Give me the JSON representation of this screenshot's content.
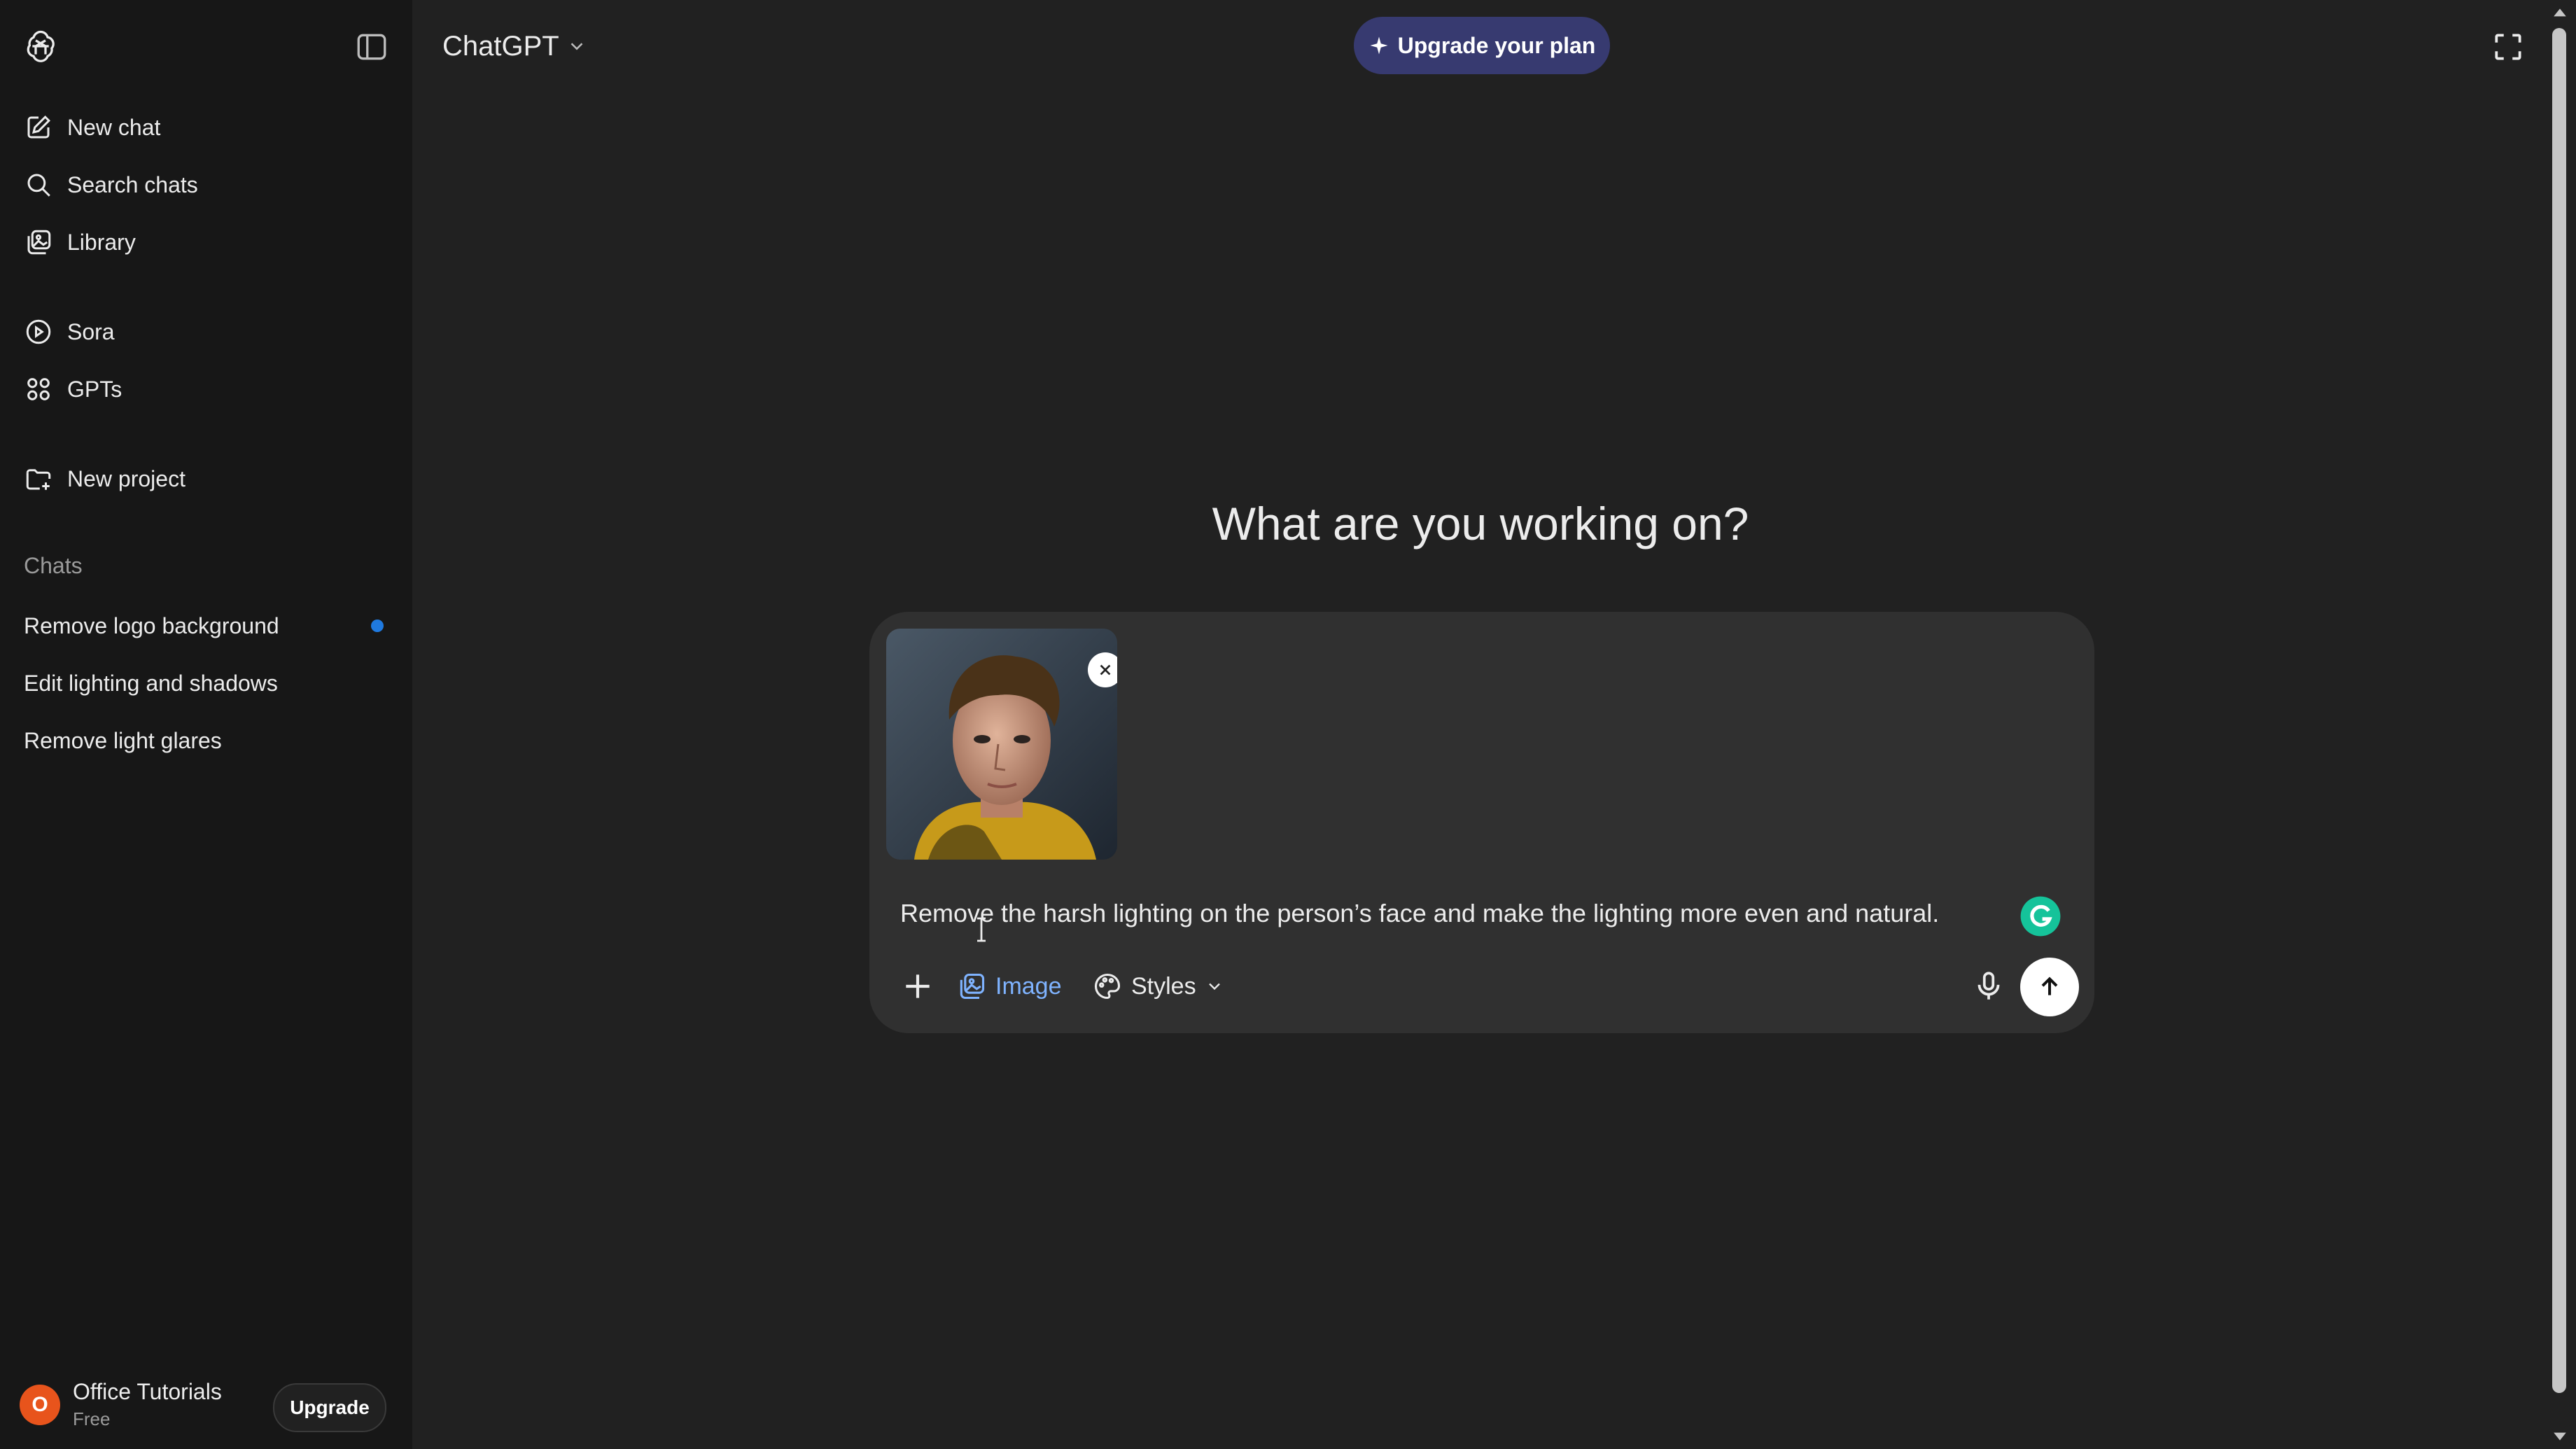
{
  "sidebar": {
    "nav": [
      {
        "label": "New chat",
        "icon": "new-chat-icon"
      },
      {
        "label": "Search chats",
        "icon": "search-icon"
      },
      {
        "label": "Library",
        "icon": "library-icon"
      },
      {
        "label": "Sora",
        "icon": "play-circle-icon"
      },
      {
        "label": "GPTs",
        "icon": "grid-icon"
      },
      {
        "label": "New project",
        "icon": "folder-plus-icon"
      }
    ],
    "chats_label": "Chats",
    "chats": [
      {
        "label": "Remove logo background",
        "unread": true
      },
      {
        "label": "Edit lighting and shadows",
        "unread": false
      },
      {
        "label": "Remove light glares",
        "unread": false
      }
    ],
    "user": {
      "initial": "O",
      "name": "Office Tutorials",
      "plan": "Free",
      "upgrade_label": "Upgrade"
    }
  },
  "header": {
    "model": "ChatGPT",
    "upgrade_plan": "Upgrade your plan"
  },
  "main": {
    "heading": "What are you working on?",
    "composer": {
      "prompt": "Remove the harsh lighting on the person’s face and make the lighting more even and natural.",
      "tools": {
        "image_label": "Image",
        "styles_label": "Styles"
      }
    }
  },
  "colors": {
    "sidebar_bg": "#171717",
    "main_bg": "#212121",
    "composer_bg": "#303030",
    "accent_upgrade": "#373a70",
    "image_tool": "#7fb3ff",
    "unread_dot": "#1f7ae0",
    "avatar": "#e8541c"
  }
}
